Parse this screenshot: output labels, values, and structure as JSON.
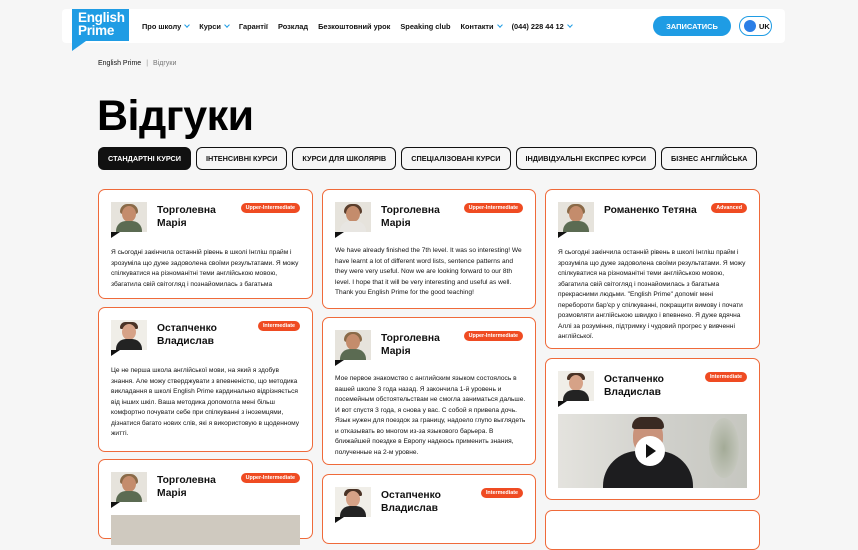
{
  "brand": {
    "logo_line1": "English",
    "logo_line2": "Prime",
    "accent": "#1f9ce4",
    "badge_color": "#ef4b22",
    "card_border": "#ef6a3a"
  },
  "nav": {
    "items": [
      {
        "label": "Про школу",
        "dropdown": true
      },
      {
        "label": "Курси",
        "dropdown": true
      },
      {
        "label": "Гарантії",
        "dropdown": false
      },
      {
        "label": "Розклад",
        "dropdown": false
      },
      {
        "label": "Безкоштовний урок",
        "dropdown": false
      },
      {
        "label": "Speaking club",
        "dropdown": false
      },
      {
        "label": "Контакти",
        "dropdown": true
      },
      {
        "label": "(044) 228 44 12",
        "dropdown": true
      }
    ],
    "cta": "ЗАПИСАТИСЬ",
    "lang": "UK"
  },
  "breadcrumb": {
    "home": "English Prime",
    "sep": "|",
    "current": "Відгуки"
  },
  "page_title": "Відгуки",
  "tabs": [
    {
      "label": "СТАНДАРТНІ КУРСИ",
      "active": true
    },
    {
      "label": "ІНТЕНСИВНІ КУРСИ",
      "active": false
    },
    {
      "label": "КУРСИ ДЛЯ ШКОЛЯРІВ",
      "active": false
    },
    {
      "label": "СПЕЦІАЛІЗОВАНІ КУРСИ",
      "active": false
    },
    {
      "label": "ІНДИВІДУАЛЬНІ ЕКСПРЕС КУРСИ",
      "active": false
    },
    {
      "label": "БІЗНЕС АНГЛІЙСЬКА",
      "active": false
    }
  ],
  "reviews": [
    {
      "name": "Торголевна Марія",
      "level": "Upper-Intermediate",
      "text": "Я сьогодні закінчила останній рівень в школі Інгліш прайм і зрозуміла що дуже задоволена своїми результатами. Я можу спілкуватися на різноманітні теми англійською мовою, збагатила свій світогляд і познайомилась з багатьма"
    },
    {
      "name": "Торголевна Марія",
      "level": "Upper-Intermediate",
      "text": "We have already finished the 7th level. It was so interesting! We have learnt a lot of different word lists, sentence patterns and they were very useful. Now we are looking forward to our 8th level. I hope that it will be very interesting and useful as well. Thank you English Prime for the good teaching!"
    },
    {
      "name": "Романенко Тетяна",
      "level": "Advanced",
      "text": "Я сьогодні закінчила останній рівень в школі Інгліш прайм і зрозуміла що дуже задоволена своїми результатами. Я можу спілкуватися на різноманітні теми англійською мовою, збагатила свій світогляд і познайомилась з багатьма прекрасними людьми. \"English Prime\" допоміг мені перебороти бар'єр у спілкуванні, покращити вимову і почати розмовляти англійською швидко і впевнено. Я дуже вдячна Аллі за розуміння, підтримку і чудовий прогрес у вивченні англійської."
    },
    {
      "name": "Остапченко Владислав",
      "level": "Intermediate",
      "text": "Це не перша школа англійської мови, на який я здобув знання. Але можу стверджувати з впевненістю, що методика викладання в школі English Prime кардинально відрізняється від інших шкіл. Ваша методика допомогла мені більш комфортно почувати себе при спілкуванні з іноземцями, дізнатися багато нових слів, які я використовую в щоденному житті."
    },
    {
      "name": "Торголевна Марія",
      "level": "Upper-Intermediate",
      "text": "Мое первое знакомство с английским языком состоялось в вашей школе 3 года назад. Я закончила 1-й уровень и посемейным обстоятельствам не смогла заниматься дальше. И вот спустя 3 года, я снова у вас. С собой я привела дочь. Язык нужен для поездок за границу, надоело глупо выглядеть и отказывать во многом из-за языкового барьера. В ближайшей поездке в Европу надеюсь применить знания, полученные на 2-м уровне."
    },
    {
      "name": "Остапченко Владислав",
      "level": "Intermediate",
      "text": ""
    },
    {
      "name": "Торголевна Марія",
      "level": "Upper-Intermediate",
      "text": ""
    },
    {
      "name": "Остапченко Владислав",
      "level": "Intermediate",
      "text": ""
    }
  ]
}
